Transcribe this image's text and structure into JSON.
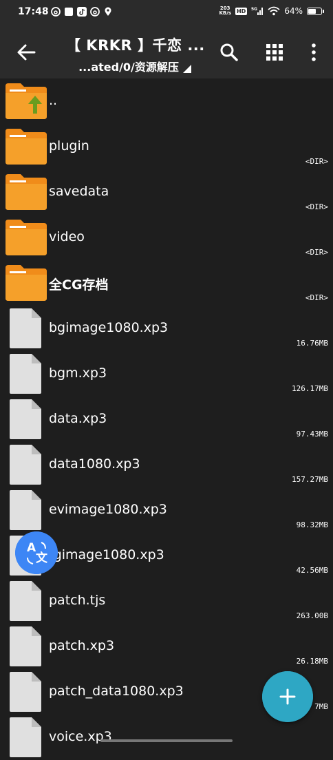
{
  "status_bar": {
    "time": "17:48",
    "net_speed_value": "203",
    "net_speed_unit": "KB/s",
    "hd": "HD",
    "signal": "5G",
    "battery_text": "64%",
    "battery_level": 0.64
  },
  "toolbar": {
    "title": "【 KRKR 】千恋 ...",
    "path": "...ated/0/资源解压"
  },
  "files": [
    {
      "name": "..",
      "type": "parent",
      "meta": ""
    },
    {
      "name": "plugin",
      "type": "folder",
      "meta": "<DIR>"
    },
    {
      "name": "savedata",
      "type": "folder",
      "meta": "<DIR>"
    },
    {
      "name": "video",
      "type": "folder",
      "meta": "<DIR>"
    },
    {
      "name": "全CG存档",
      "type": "folder",
      "meta": "<DIR>"
    },
    {
      "name": "bgimage1080.xp3",
      "type": "file",
      "meta": "16.76MB"
    },
    {
      "name": "bgm.xp3",
      "type": "file",
      "meta": "126.17MB"
    },
    {
      "name": "data.xp3",
      "type": "file",
      "meta": "97.43MB"
    },
    {
      "name": "data1080.xp3",
      "type": "file",
      "meta": "157.27MB"
    },
    {
      "name": "evimage1080.xp3",
      "type": "file",
      "meta": "98.32MB"
    },
    {
      "name": "fgimage1080.xp3",
      "type": "file",
      "meta": "42.56MB"
    },
    {
      "name": "patch.tjs",
      "type": "file",
      "meta": "263.00B"
    },
    {
      "name": "patch.xp3",
      "type": "file",
      "meta": "26.18MB"
    },
    {
      "name": "patch_data1080.xp3",
      "type": "file",
      "meta": "7MB"
    },
    {
      "name": "voice.xp3",
      "type": "file",
      "meta": ""
    }
  ],
  "colors": {
    "background": "#1e1e1e",
    "bar": "#2b2b2b",
    "folder": "#f5a02a",
    "folder_tab": "#f08c1a",
    "up_arrow": "#6b9c1f",
    "doc": "#e0e0e0",
    "fab": "#2ea7c4",
    "translate": "#3d86f5"
  },
  "icons": {
    "back": "arrow-left-icon",
    "search": "search-icon",
    "grid": "grid-view-icon",
    "more": "more-vertical-icon",
    "add": "plus-icon",
    "translate": "translate-icon"
  }
}
